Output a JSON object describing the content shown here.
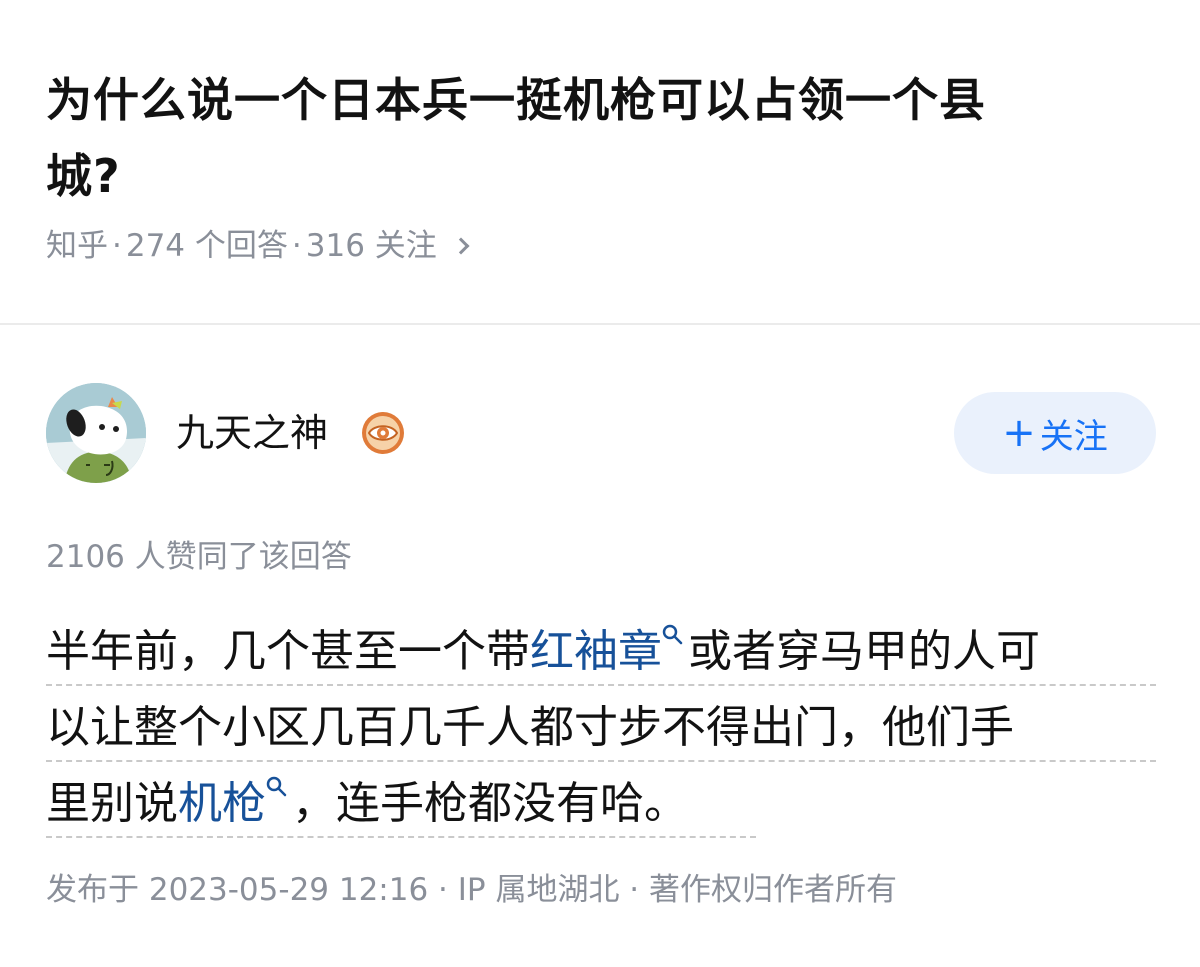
{
  "question": {
    "title_line1": "为什么说一个日本兵一挺机枪可以占领一个县",
    "title_line2": "城?",
    "source": "知乎",
    "answer_count": "274 个回答",
    "follow_count": "316 关注",
    "chevron_icon": "chevron-right-icon"
  },
  "author": {
    "name": "九天之神",
    "avatar_icon": "dog-avatar-icon",
    "badge_icon": "eye-badge-icon",
    "badge_color": "#e07b39",
    "follow_label": "关注"
  },
  "answer": {
    "votes": "2106 人赞同了该回答",
    "line1_pre": "半年前，几个甚至一个带",
    "line1_kw": "红袖章",
    "line1_post": "或者穿马甲的人可",
    "line2": "以让整个小区几百几千人都寸步不得出门，他们手",
    "line3_pre": "里别说",
    "line3_kw": "机枪",
    "line3_post": "，连手枪都没有哈。",
    "published": "发布于 2023-05-29 12:16 · IP 属地湖北 · 著作权归作者所有"
  },
  "colors": {
    "accent": "#1772f6",
    "keyword": "#175199",
    "meta_text": "#8a8f99",
    "follow_bg": "#eaf1fc"
  }
}
